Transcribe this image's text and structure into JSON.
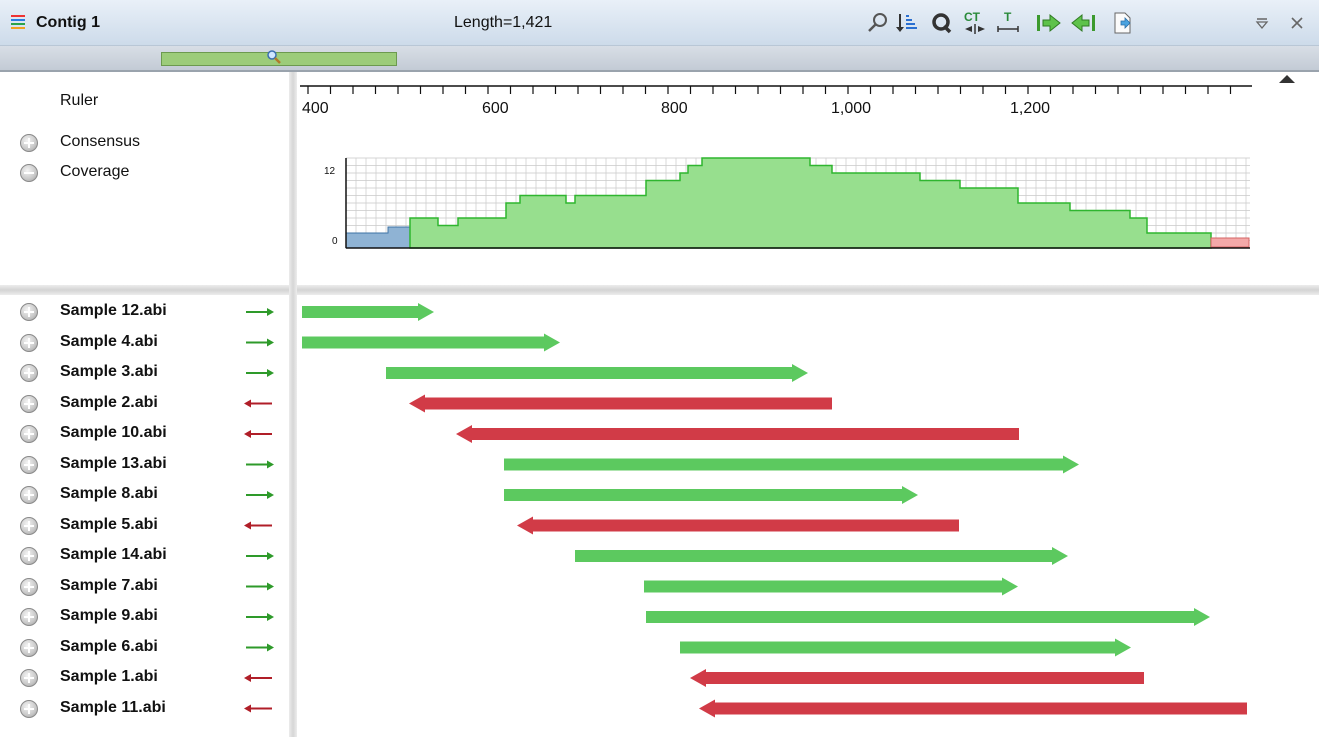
{
  "header": {
    "title": "Contig 1",
    "length_label": "Length=1,421"
  },
  "toolbar": {
    "icons": [
      "zoom-icon",
      "sort-icon",
      "quality-icon",
      "ct-icon",
      "t-align-icon",
      "go-next-icon",
      "go-prev-icon",
      "export-icon",
      "menu-icon",
      "close-icon"
    ]
  },
  "tracks": {
    "ruler": "Ruler",
    "consensus": "Consensus",
    "coverage": "Coverage"
  },
  "ruler": {
    "labels": [
      "400",
      "600",
      "800",
      "1,000",
      "1,200"
    ]
  },
  "coverage": {
    "max_label": "12",
    "min_label": "0"
  },
  "colors": {
    "forward": "#5cc95f",
    "reverse": "#d13b47",
    "coverage_fill": "#97df8e",
    "coverage_line": "#2fb52f",
    "low_coverage": "#8fb3d4"
  },
  "samples": [
    {
      "name": "Sample 12.abi",
      "direction": "forward"
    },
    {
      "name": "Sample 4.abi",
      "direction": "forward"
    },
    {
      "name": "Sample 3.abi",
      "direction": "forward"
    },
    {
      "name": "Sample 2.abi",
      "direction": "reverse"
    },
    {
      "name": "Sample 10.abi",
      "direction": "reverse"
    },
    {
      "name": "Sample 13.abi",
      "direction": "forward"
    },
    {
      "name": "Sample 8.abi",
      "direction": "forward"
    },
    {
      "name": "Sample 5.abi",
      "direction": "reverse"
    },
    {
      "name": "Sample 14.abi",
      "direction": "forward"
    },
    {
      "name": "Sample 7.abi",
      "direction": "forward"
    },
    {
      "name": "Sample 9.abi",
      "direction": "forward"
    },
    {
      "name": "Sample 6.abi",
      "direction": "forward"
    },
    {
      "name": "Sample 1.abi",
      "direction": "reverse"
    },
    {
      "name": "Sample 11.abi",
      "direction": "reverse"
    }
  ]
}
